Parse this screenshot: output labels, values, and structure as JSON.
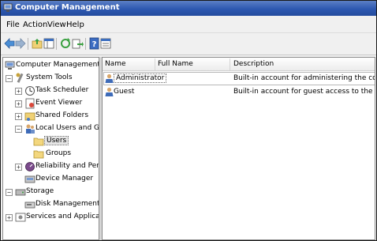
{
  "window": {
    "title": "Computer Management"
  },
  "menu": [
    "File",
    "Action",
    "View",
    "Help"
  ],
  "toolbar": {
    "buttons": [
      "back-arrow-icon",
      "forward-arrow-icon",
      "up-folder-icon",
      "show-hide-tree-icon",
      "refresh-icon",
      "export-list-icon",
      "help-icon",
      "properties-icon"
    ]
  },
  "tree": {
    "root": "Computer Management (Local)",
    "system_tools": "System Tools",
    "task_scheduler": "Task Scheduler",
    "event_viewer": "Event Viewer",
    "shared_folders": "Shared Folders",
    "local_users_groups": "Local Users and Groups",
    "users": "Users",
    "groups": "Groups",
    "reliability": "Reliability and Performanc",
    "device_manager": "Device Manager",
    "storage": "Storage",
    "disk_management": "Disk Management",
    "services_apps": "Services and Applications",
    "expander_plus": "+",
    "expander_minus": "−"
  },
  "list": {
    "columns": [
      "Name",
      "Full Name",
      "Description"
    ],
    "rows": [
      {
        "name": "Administrator",
        "full_name": "",
        "description": "Built-in account for administering the computer/domain"
      },
      {
        "name": "Guest",
        "full_name": "",
        "description": "Built-in account for guest access to the computer/do..."
      }
    ]
  },
  "colors": {
    "title_bar": "#2d58b0",
    "selection": "#e5e5e5"
  }
}
